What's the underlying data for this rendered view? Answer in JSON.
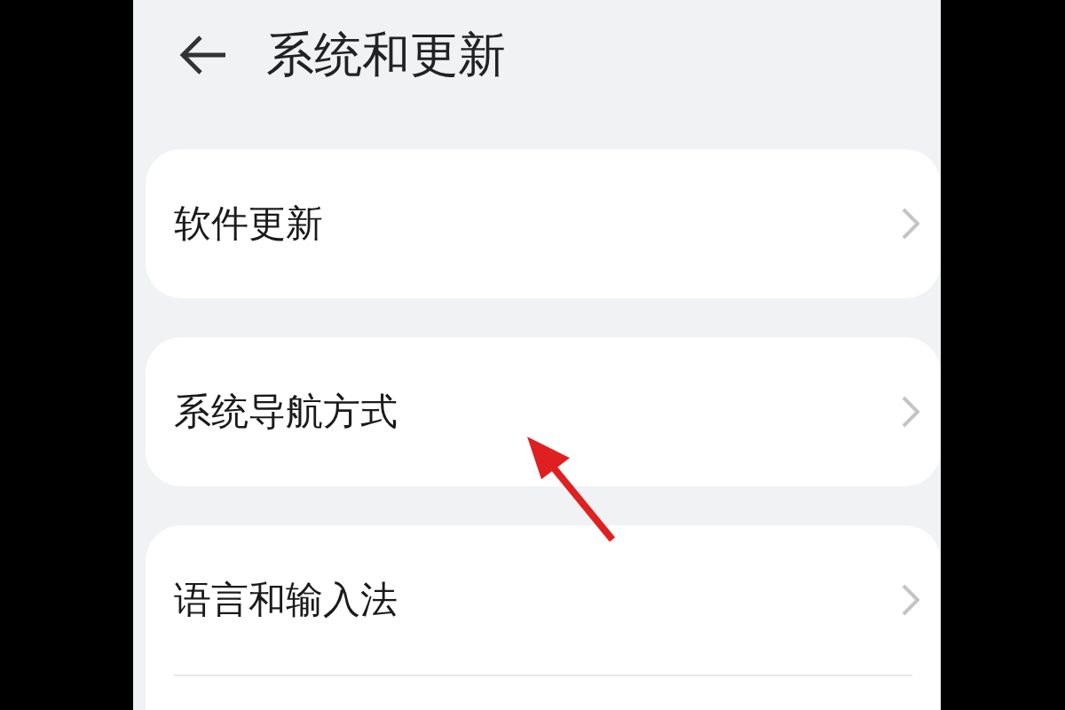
{
  "header": {
    "title": "系统和更新"
  },
  "groups": [
    {
      "items": [
        {
          "label": "软件更新"
        }
      ]
    },
    {
      "items": [
        {
          "label": "系统导航方式"
        }
      ]
    },
    {
      "items": [
        {
          "label": "语言和输入法"
        }
      ]
    }
  ],
  "annotation": {
    "kind": "arrow"
  }
}
